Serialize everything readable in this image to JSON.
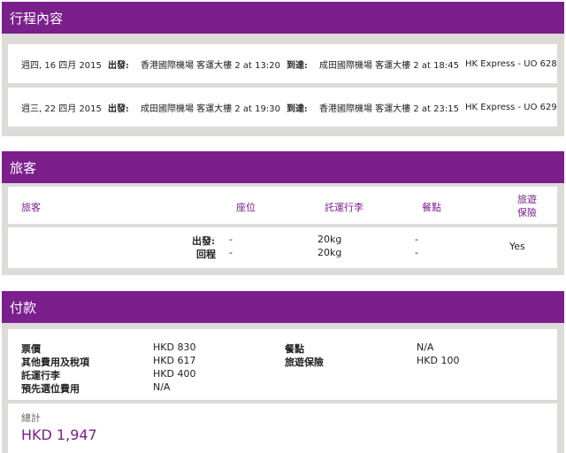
{
  "itinerary": {
    "title": "行程內容",
    "flights": [
      {
        "date": "週四, 16 四月 2015",
        "depart_label": "出發:",
        "depart": "香港國際機場 客運大樓 2 at 13:20",
        "arrive_label": "到達:",
        "arrive": "成田國際機場 客運大樓 2 at 18:45",
        "airline": "HK Express - UO 628"
      },
      {
        "date": "週三, 22 四月 2015",
        "depart_label": "出發:",
        "depart": "成田國際機場 客運大樓 2 at 19:30",
        "arrive_label": "到達:",
        "arrive": "香港國際機場 客運大樓 2 at 23:15",
        "airline": "HK Express - UO 629"
      }
    ]
  },
  "passengers": {
    "title": "旅客",
    "columns": {
      "passenger": "旅客",
      "seat": "座位",
      "baggage": "託運行李",
      "meal": "餐點",
      "insurance_line1": "旅遊",
      "insurance_line2": "保險"
    },
    "rows": [
      {
        "label": "出發:",
        "seat": "-",
        "baggage": "20kg",
        "meal": "-"
      },
      {
        "label": "回程",
        "seat": "-",
        "baggage": "20kg",
        "meal": "-"
      }
    ],
    "insurance": "Yes"
  },
  "payment": {
    "title": "付款",
    "items_left": [
      {
        "label": "票價",
        "value": "HKD 830"
      },
      {
        "label": "其他費用及稅項",
        "value": "HKD 617"
      },
      {
        "label": "託運行李",
        "value": "HKD 400"
      },
      {
        "label": "預先選位費用",
        "value": "N/A"
      }
    ],
    "items_right": [
      {
        "label": "餐點",
        "value": "N/A"
      },
      {
        "label": "旅遊保險",
        "value": "HKD 100"
      }
    ],
    "total_label": "總計",
    "total_value": "HKD 1,947"
  }
}
